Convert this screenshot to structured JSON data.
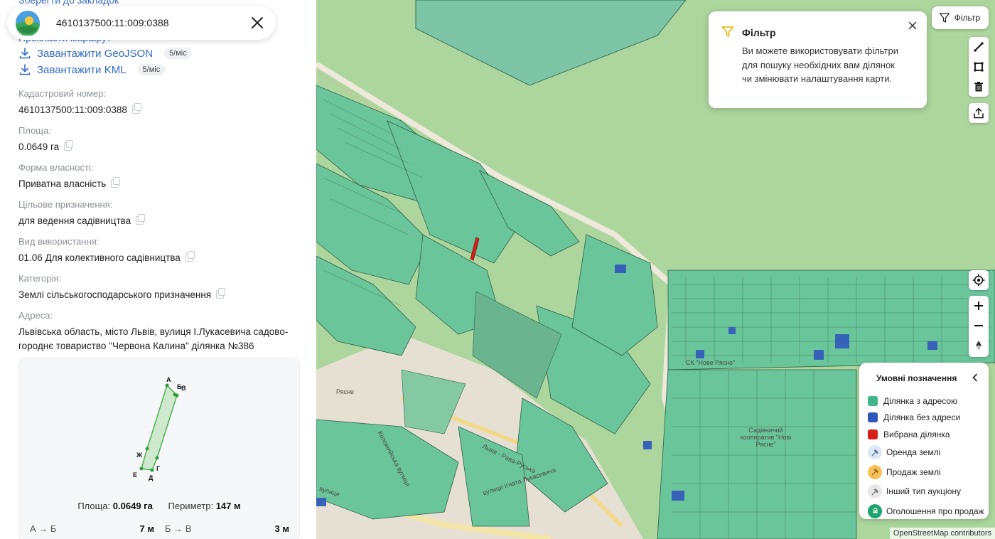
{
  "search": {
    "query": "4610137500:11:009:0388",
    "logo_icon": "app-logo",
    "close_icon": "close-icon"
  },
  "panel": {
    "cut_top_link": "Зберегти до закладок",
    "cut_mid_link": "Прокласти маршрут",
    "downloads": [
      {
        "label": "Завантажити GeoJSON",
        "badge": "5/міс"
      },
      {
        "label": "Завантажити KML",
        "badge": "5/міс"
      }
    ],
    "fields": [
      {
        "label": "Кадастровий номер:",
        "value": "4610137500:11:009:0388"
      },
      {
        "label": "Площа:",
        "value": "0.0649 га"
      },
      {
        "label": "Форма власності:",
        "value": "Приватна власність"
      },
      {
        "label": "Цільове призначення:",
        "value": "для ведення садівництва"
      },
      {
        "label": "Вид використання:",
        "value": "01.06 Для колективного садівництва"
      },
      {
        "label": "Категорія:",
        "value": "Землі сільськогосподарського призначення"
      },
      {
        "label": "Адреса:",
        "value": "Львівська область, місто Львів, вулиця І.Лукасевича садово-городнє товариство \"Червона Калина\" ділянка №386"
      }
    ],
    "shape": {
      "vertex_labels": [
        "А",
        "Б",
        "В",
        "Г",
        "Д",
        "Е",
        "Ж"
      ],
      "area_label": "Площа:",
      "area_value": "0.0649 га",
      "perimeter_label": "Периметр:",
      "perimeter_value": "147 м",
      "segments": [
        {
          "label": "А → Б",
          "value": "7 м"
        },
        {
          "label": "Б → В",
          "value": "3 м"
        }
      ]
    }
  },
  "map": {
    "filter_button": "Фільтр",
    "filter_popup": {
      "title": "Фільтр",
      "text": "Ви можете використовувати фільтри для пошуку необхідних вам ділянок чи змінювати налаштування карти."
    },
    "labels": {
      "ryasne": "Рясне",
      "coop": "Садівничий кооператив \"Нові Рясне\"",
      "street_ignata": "вулиця Ігната Лукасевича",
      "street_lvivrava": "Львів - Рава-Руська",
      "street_vulytsia": "вулиця",
      "street_kolomyiska": "Коломийська вулиця",
      "sk": "СК \"Нове Рясне\""
    },
    "legend": {
      "title": "Умовні позначення",
      "items": [
        {
          "label": "Ділянка з адресою",
          "color": "#3eb68a",
          "kind": "square"
        },
        {
          "label": "Ділянка без адреси",
          "color": "#2c57b8",
          "kind": "square"
        },
        {
          "label": "Вибрана ділянка",
          "color": "#d8201a",
          "kind": "square"
        },
        {
          "label": "Оренда землі",
          "color": "#dbe8f5",
          "kind": "circle"
        },
        {
          "label": "Продаж землі",
          "color": "#f6c15a",
          "kind": "circle"
        },
        {
          "label": "Інший тип аукціону",
          "color": "#e7e7e7",
          "kind": "circle"
        },
        {
          "label": "Оголошення про продаж",
          "color": "#1fa46e",
          "kind": "circle"
        }
      ]
    },
    "attribution": "OpenStreetMap contributors"
  }
}
